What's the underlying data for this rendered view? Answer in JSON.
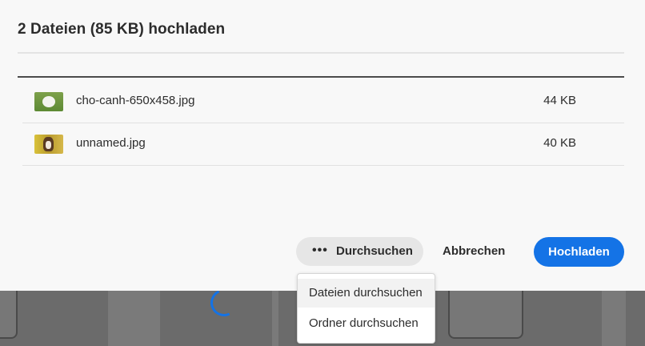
{
  "dialog": {
    "title": "2 Dateien (85 KB) hochladen"
  },
  "files": [
    {
      "name": "cho-canh-650x458.jpg",
      "size": "44 KB",
      "thumbnail": "white-dog-on-grass-image"
    },
    {
      "name": "unnamed.jpg",
      "size": "40 KB",
      "thumbnail": "puppy-in-flowers-image"
    }
  ],
  "actions": {
    "browse_icon": "more-dots-icon",
    "browse_label": "Durchsuchen",
    "cancel_label": "Abbrechen",
    "upload_label": "Hochladen"
  },
  "browse_menu": {
    "items": [
      "Dateien durchsuchen",
      "Ordner durchsuchen"
    ]
  },
  "colors": {
    "accent": "#1473e6",
    "modal_bg": "#f8f8f8"
  }
}
